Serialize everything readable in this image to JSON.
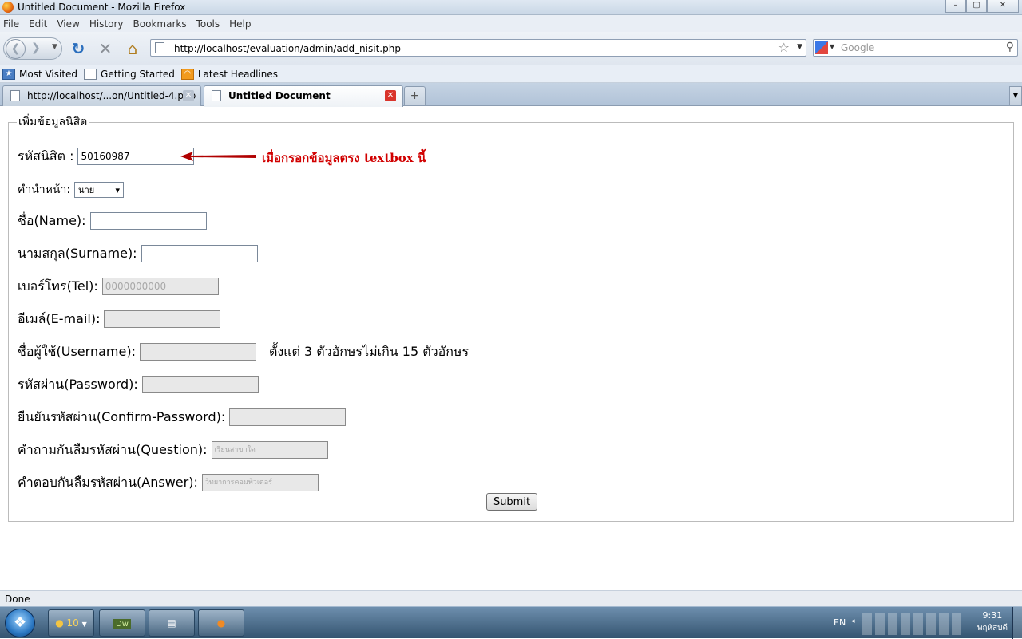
{
  "window": {
    "title": "Untitled Document - Mozilla Firefox",
    "controls": {
      "minimize": "–",
      "maximize": "▢",
      "close": "✕"
    }
  },
  "menubar": {
    "items": [
      {
        "label": "File"
      },
      {
        "label": "Edit"
      },
      {
        "label": "View"
      },
      {
        "label": "History"
      },
      {
        "label": "Bookmarks"
      },
      {
        "label": "Tools"
      },
      {
        "label": "Help"
      }
    ]
  },
  "navbar": {
    "url": "http://localhost/evaluation/admin/add_nisit.php",
    "search_placeholder": "Google"
  },
  "bookmarks": {
    "items": [
      {
        "label": "Most Visited",
        "icon": "most-visited-icon"
      },
      {
        "label": "Getting Started",
        "icon": "page-icon"
      },
      {
        "label": "Latest Headlines",
        "icon": "rss-icon"
      }
    ]
  },
  "tabs": [
    {
      "label": "http://localhost/...on/Untitled-4.php",
      "active": false
    },
    {
      "label": "Untitled Document",
      "active": true
    }
  ],
  "form": {
    "legend": "เพิ่มข้อมูลนิสิต",
    "student_id_label": "รหัสนิสิต  :",
    "student_id_value": "50160987",
    "prefix_label": "คำนำหน้า:",
    "prefix_value": "นาย",
    "name_label": "ชื่อ(Name):",
    "surname_label": "นามสกุล(Surname):",
    "tel_label": "เบอร์โทร(Tel):",
    "tel_placeholder": "0000000000",
    "email_label": "อีเมล์(E-mail):",
    "username_label": "ชื่อผู้ใช้(Username):",
    "username_hint": "ตั้งแต่ 3 ตัวอักษรไม่เกิน 15 ตัวอักษร",
    "password_label": "รหัสผ่าน(Password):",
    "confirm_label": "ยืนยันรหัสผ่าน(Confirm-Password):",
    "question_label": "คำถามกันลืมรหัสผ่าน(Question):",
    "question_placeholder": "เรียนสาขาใด",
    "answer_label": "คำตอบกันลืมรหัสผ่าน(Answer):",
    "answer_placeholder": "วิทยาการคอมพิวเตอร์",
    "submit_label": "Submit"
  },
  "annotation": {
    "text": "เมื่อกรอกข้อมูลตรง textbox นี้",
    "color": "#d10000"
  },
  "status": {
    "text": "Done"
  },
  "taskbar": {
    "chrome_count": "10",
    "dw_label": "Dw",
    "lang": "EN",
    "time": "9:31",
    "day": "พฤหัสบดี"
  }
}
